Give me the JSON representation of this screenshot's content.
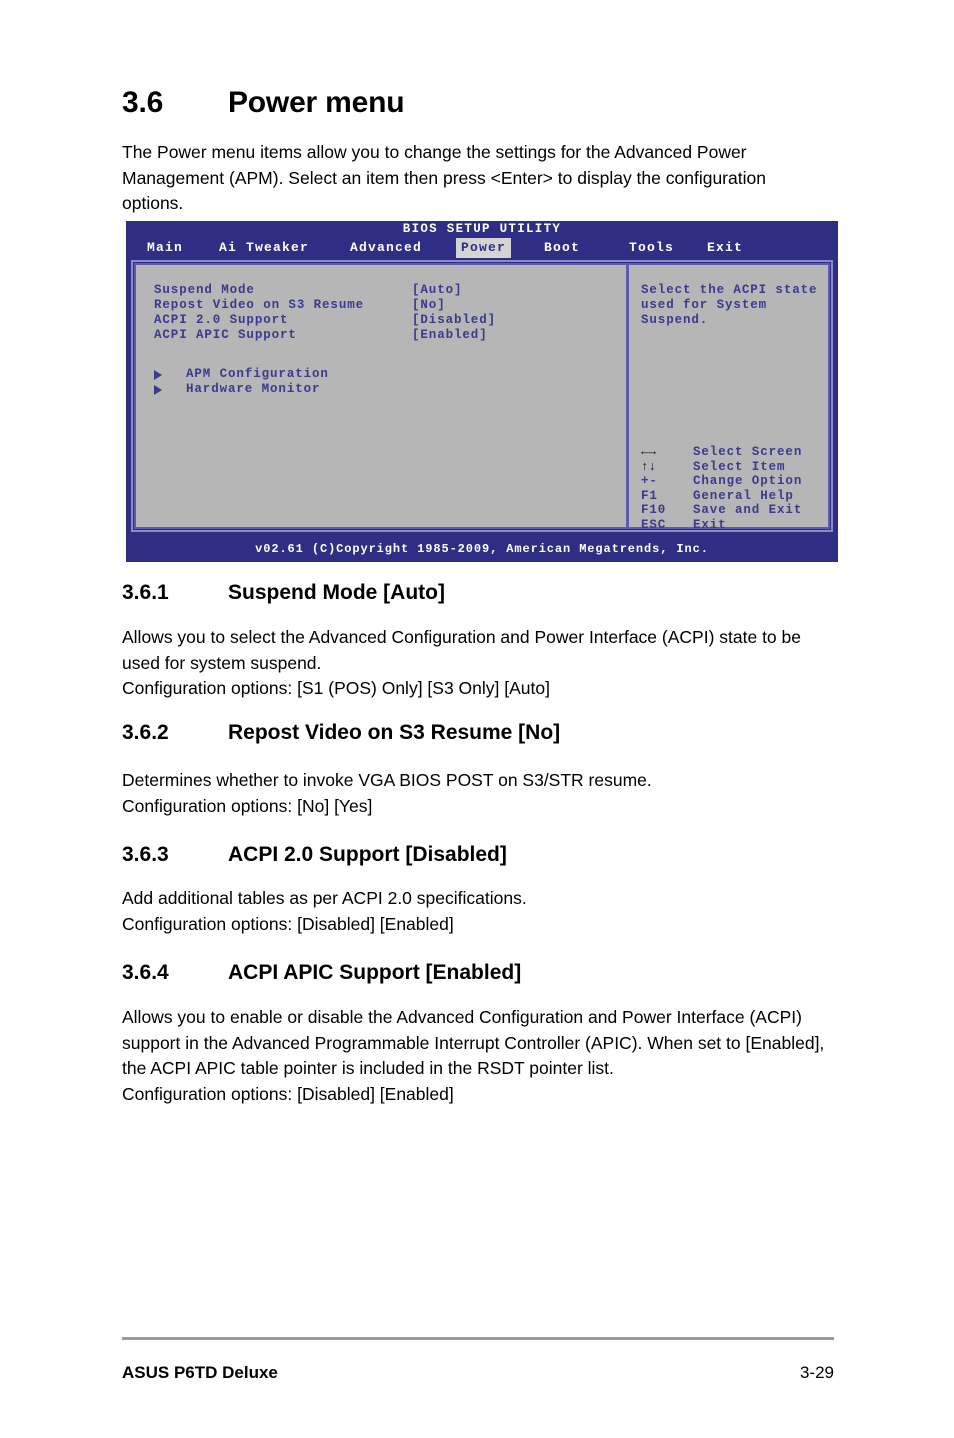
{
  "document": {
    "section_number": "3.6",
    "section_title": "Power menu",
    "intro": "The Power menu items allow you to change the settings for the Advanced Power Management (APM). Select an item then press <Enter> to display the configuration options."
  },
  "bios_screen": {
    "title": "BIOS SETUP UTILITY",
    "tabs": [
      {
        "label": "Main",
        "selected": false
      },
      {
        "label": "Ai Tweaker",
        "selected": false
      },
      {
        "label": "Advanced",
        "selected": false
      },
      {
        "label": "Power",
        "selected": true
      },
      {
        "label": "Boot",
        "selected": false
      },
      {
        "label": "Tools",
        "selected": false
      },
      {
        "label": "Exit",
        "selected": false
      }
    ],
    "settings": [
      {
        "label": "Suspend Mode",
        "value": "[Auto]"
      },
      {
        "label": "Repost Video on S3 Resume",
        "value": "[No]"
      },
      {
        "label": "ACPI 2.0 Support",
        "value": "[Disabled]"
      },
      {
        "label": "ACPI APIC Support",
        "value": "[Enabled]"
      }
    ],
    "submenus": [
      {
        "label": "APM Configuration"
      },
      {
        "label": "Hardware Monitor"
      }
    ],
    "help_lines": [
      "Select the ACPI state",
      "used for System",
      "Suspend."
    ],
    "legend": [
      {
        "key": "←→",
        "action": "Select Screen"
      },
      {
        "key": "↑↓",
        "action": "Select Item"
      },
      {
        "key": "+-",
        "action": "Change Option"
      },
      {
        "key": "F1",
        "action": "General Help"
      },
      {
        "key": "F10",
        "action": "Save and Exit"
      },
      {
        "key": "ESC",
        "action": "Exit"
      }
    ],
    "footer": "v02.61 (C)Copyright 1985-2009, American Megatrends, Inc.",
    "colors": {
      "chrome": "#2e2e84",
      "panel": "#b6b6b6",
      "text": "#3a3a8e",
      "selected_tab_bg": "#d4d4d4"
    }
  },
  "subsections": [
    {
      "number": "3.6.1",
      "title": "Suspend Mode [Auto]",
      "body": "Allows you to select the Advanced Configuration and Power Interface (ACPI) state to be used for system suspend.",
      "options": "Configuration options: [S1 (POS) Only] [S3 Only] [Auto]"
    },
    {
      "number": "3.6.2",
      "title": "Repost Video on S3 Resume [No]",
      "body": "Determines whether to invoke VGA BIOS POST on S3/STR resume.",
      "options": "Configuration options: [No] [Yes]"
    },
    {
      "number": "3.6.3",
      "title": "ACPI 2.0 Support [Disabled]",
      "body": "Add additional tables as per ACPI 2.0 specifications.",
      "options": "Configuration options: [Disabled] [Enabled]"
    },
    {
      "number": "3.6.4",
      "title": "ACPI APIC Support [Enabled]",
      "body": "Allows you to enable or disable the Advanced Configuration and Power Interface (ACPI) support in the Advanced Programmable Interrupt Controller (APIC). When set to [Enabled], the ACPI APIC table pointer is included in the RSDT pointer list.",
      "options": "Configuration options: [Disabled] [Enabled]"
    }
  ],
  "page_footer": {
    "left": "ASUS P6TD Deluxe",
    "right": "3-29"
  }
}
